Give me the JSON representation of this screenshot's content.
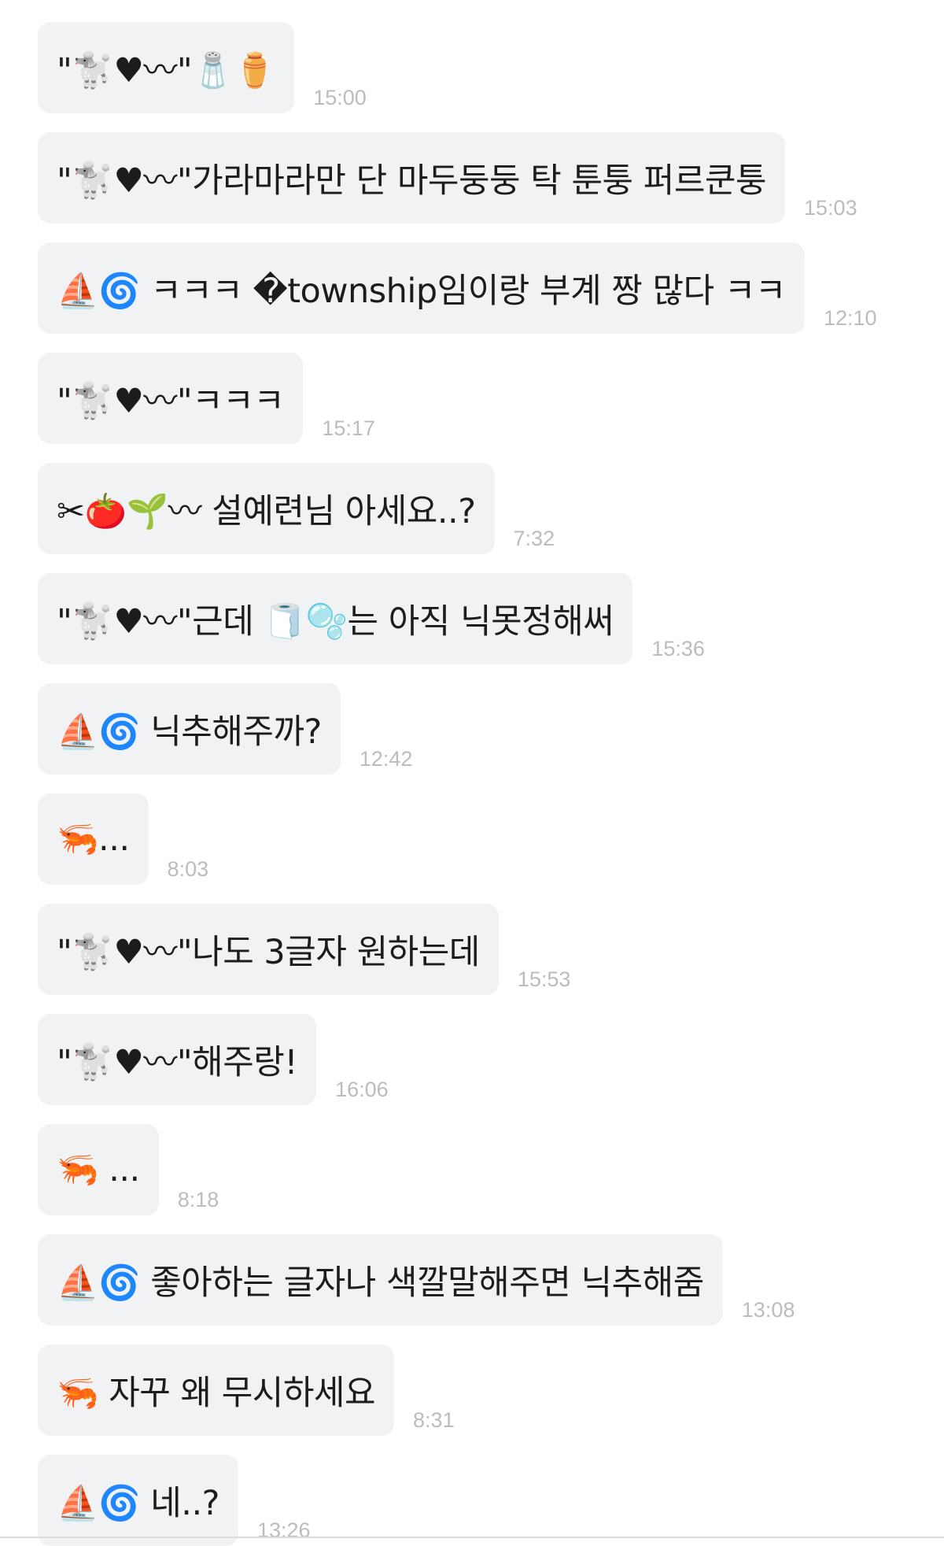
{
  "messages": [
    {
      "text": "\"🐩♥︎〰\"🧂⚱️",
      "time": "15:00"
    },
    {
      "text": "\"🐩♥︎〰\"가라마라만 단 마두둥둥 탁 툰퉁 퍼르쿤퉁",
      "time": "15:03"
    },
    {
      "text": "⛵🌀 ㅋㅋㅋ �township임이랑 부계 짱 많다 ㅋㅋ",
      "time": "12:10"
    },
    {
      "text": "\"🐩♥︎〰\"ㅋㅋㅋ",
      "time": "15:17"
    },
    {
      "text": "✂🍅🌱〰 설예련님 아세요..?",
      "time": "7:32"
    },
    {
      "text": "\"🐩♥︎〰\"근데 🧻🫧는 아직 닉못정해써",
      "time": "15:36"
    },
    {
      "text": "⛵🌀 닉추해주까?",
      "time": "12:42"
    },
    {
      "text": "🦐...",
      "time": "8:03"
    },
    {
      "text": "\"🐩♥︎〰\"나도 3글자 원하는데",
      "time": "15:53"
    },
    {
      "text": "\"🐩♥︎〰\"해주랑!",
      "time": "16:06"
    },
    {
      "text": "🦐 ...",
      "time": "8:18"
    },
    {
      "text": "⛵🌀 좋아하는 글자나 색깔말해주면 닉추해줌",
      "time": "13:08"
    },
    {
      "text": "🦐 자꾸 왜 무시하세요",
      "time": "8:31"
    },
    {
      "text": "⛵🌀 네..?",
      "time": "13:26"
    }
  ]
}
